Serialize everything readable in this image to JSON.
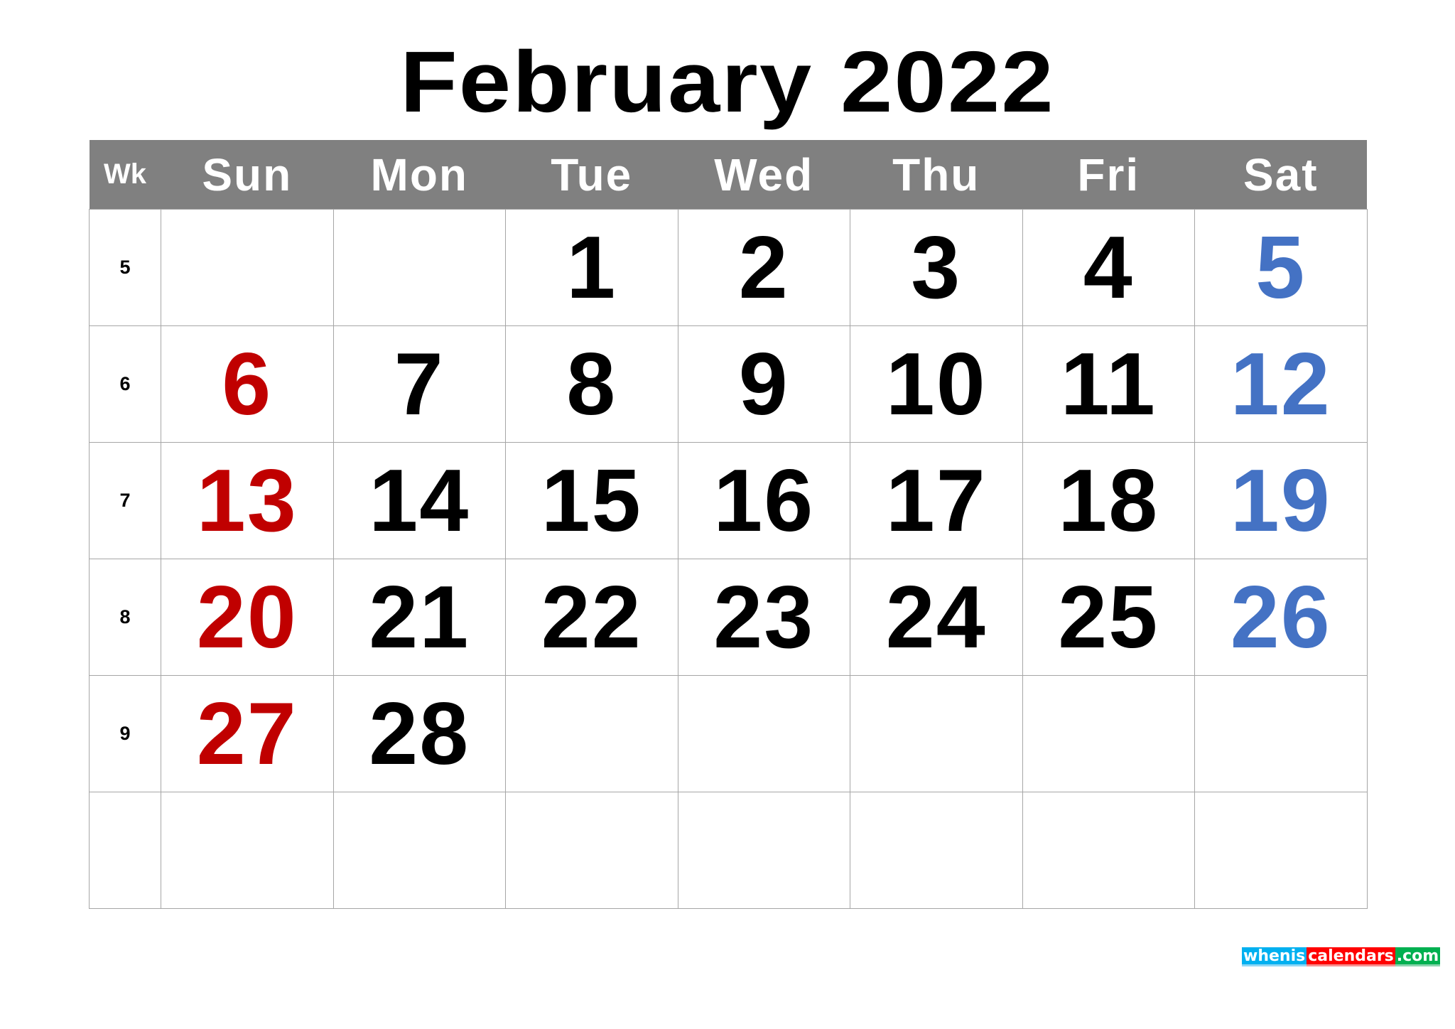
{
  "title": "February 2022",
  "header": {
    "week_label": "Wk",
    "days": [
      "Sun",
      "Mon",
      "Tue",
      "Wed",
      "Thu",
      "Fri",
      "Sat"
    ]
  },
  "colors": {
    "header_bg": "#808080",
    "sunday": "#c00000",
    "saturday": "#4472c4",
    "weekday": "#000000"
  },
  "weeks": [
    {
      "wk": "5",
      "days": [
        "",
        "",
        "1",
        "2",
        "3",
        "4",
        "5"
      ]
    },
    {
      "wk": "6",
      "days": [
        "6",
        "7",
        "8",
        "9",
        "10",
        "11",
        "12"
      ]
    },
    {
      "wk": "7",
      "days": [
        "13",
        "14",
        "15",
        "16",
        "17",
        "18",
        "19"
      ]
    },
    {
      "wk": "8",
      "days": [
        "20",
        "21",
        "22",
        "23",
        "24",
        "25",
        "26"
      ]
    },
    {
      "wk": "9",
      "days": [
        "27",
        "28",
        "",
        "",
        "",
        "",
        ""
      ]
    },
    {
      "wk": "",
      "days": [
        "",
        "",
        "",
        "",
        "",
        "",
        ""
      ]
    }
  ],
  "watermark": {
    "parts": [
      "whenis",
      "calendars",
      ".com"
    ],
    "colors": [
      "#00b0f0",
      "#ff0000",
      "#00b050"
    ]
  }
}
